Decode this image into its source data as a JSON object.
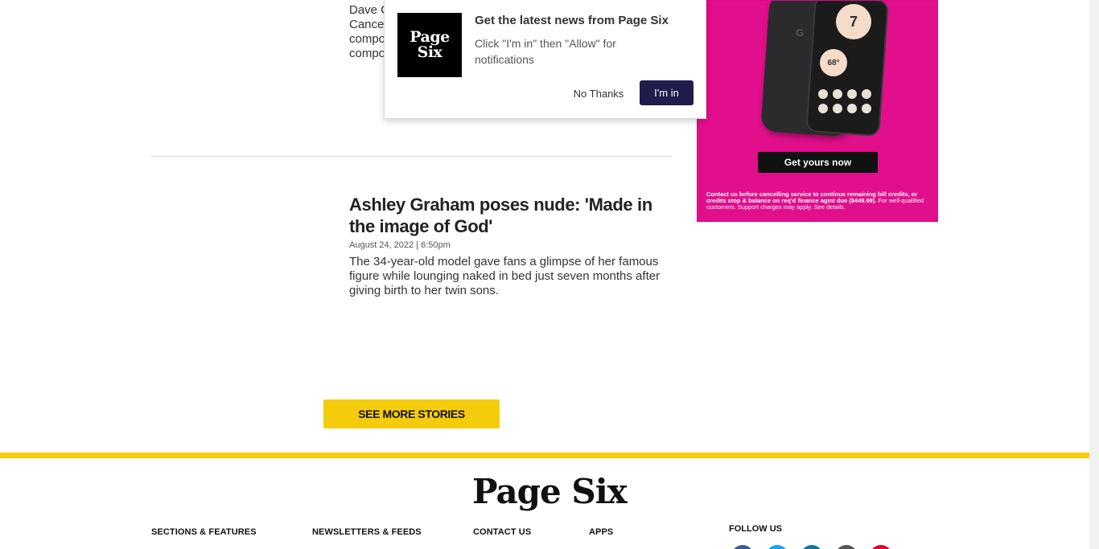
{
  "top_article": {
    "excerpt_lines": [
      "Dave C",
      "Cance",
      "compo",
      "compo"
    ]
  },
  "article": {
    "title": "Ashley Graham poses nude: 'Made in the image of God'",
    "date": "August 24, 2022 | 6:50pm",
    "excerpt": "The 34-year-old model gave fans a glimpse of her famous figure while lounging naked in bed just seven months after giving birth to her twin sons."
  },
  "see_more_label": "SEE MORE STORIES",
  "notification": {
    "logo_line1": "Page",
    "logo_line2": "Six",
    "title": "Get the latest news from Page Six",
    "message": "Click \"I'm in\" then \"Allow\" for notifications",
    "decline_label": "No Thanks",
    "accept_label": "I'm in",
    "accept_color": "#1f1c4e"
  },
  "ad": {
    "background_color": "#e20f8c",
    "phone_logo": "G",
    "clock": "7",
    "weather": "68°",
    "cta_label": "Get yours now",
    "fine_print_bold": "Contact us before cancelling service to continue remaining bill credits, or credits stop & balance on req'd finance agmt due ($449.99).",
    "fine_print": " For well-qualified customers. Support charges may apply. See details."
  },
  "footer": {
    "accent_color": "#f5cc0b",
    "logo": "Page Six",
    "headings": [
      "SECTIONS & FEATURES",
      "NEWSLETTERS & FEEDS",
      "CONTACT US",
      "APPS"
    ],
    "follow_us": "FOLLOW US",
    "social_icons": [
      "facebook-icon",
      "twitter-icon",
      "linkedin-icon",
      "instagram-icon",
      "pinterest-icon"
    ]
  }
}
